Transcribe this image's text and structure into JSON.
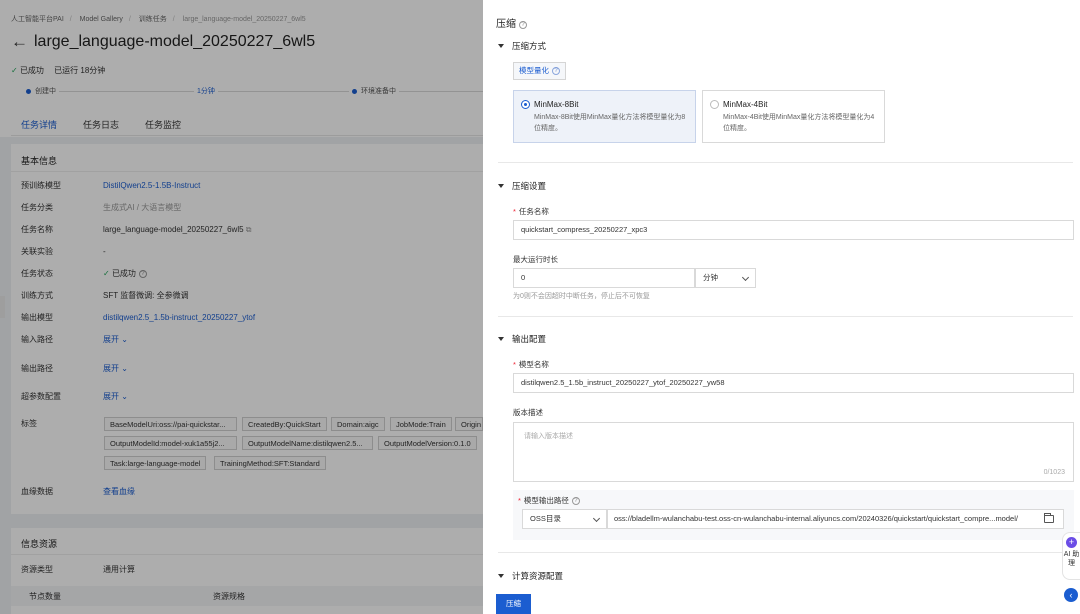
{
  "background": {
    "breadcrumb": [
      "人工智能平台PAI",
      "Model Gallery",
      "训练任务",
      "large_language-model_20250227_6wl5"
    ],
    "title": "large_language-model_20250227_6wl5",
    "status": "已成功",
    "runtime": "已运行 18分钟",
    "progress": {
      "step1": "创建中",
      "step2": "1分钟",
      "step3": "环境准备中"
    },
    "tabs": [
      "任务详情",
      "任务日志",
      "任务监控"
    ],
    "basic_info": {
      "title": "基本信息",
      "rows": [
        {
          "k": "预训练模型",
          "v": "DistilQwen2.5-1.5B-Instruct"
        },
        {
          "k": "任务分类",
          "v": "生成式AI / 大语言模型"
        },
        {
          "k": "任务名称",
          "v": "large_language-model_20250227_6wl5"
        },
        {
          "k": "关联实验",
          "v": "-"
        },
        {
          "k": "任务状态",
          "v": "已成功"
        },
        {
          "k": "训练方式",
          "v": "SFT 监督微调: 全参微调"
        },
        {
          "k": "输出模型",
          "v": "distilqwen2.5_1.5b-instruct_20250227_ytof"
        },
        {
          "k": "输入路径",
          "v": "展开"
        },
        {
          "k": "输出路径",
          "v": "展开"
        },
        {
          "k": "超参数配置",
          "v": "展开"
        },
        {
          "k": "标签",
          "v": ""
        },
        {
          "k": "血缘数据",
          "v": "查看血缘"
        }
      ],
      "tags": [
        "BaseModelUri:oss://pai-quickstar...",
        "CreatedBy:QuickStart",
        "Domain:aigc",
        "JobMode:Train",
        "Origin",
        "OutputModelId:model-xuk1a55j2...",
        "OutputModelName:distilqwen2.5...",
        "OutputModelVersion:0.1.0",
        "Task:large-language-model",
        "TrainingMethod:SFT:Standard"
      ]
    },
    "resource": {
      "title": "信息资源",
      "type_label": "资源类型",
      "type_value": "通用计算",
      "col_nodes": "节点数量",
      "col_spec": "资源规格"
    }
  },
  "drawer": {
    "title": "压缩",
    "section_method": "压缩方式",
    "quant_pill": "模型量化",
    "options": [
      {
        "name": "MinMax-8Bit",
        "desc": "MinMax-8Bit使用MinMax量化方法将模型量化为8位精度。",
        "selected": true
      },
      {
        "name": "MinMax-4Bit",
        "desc": "MinMax-4Bit使用MinMax量化方法将模型量化为4位精度。",
        "selected": false
      }
    ],
    "section_settings": "压缩设置",
    "task_name_label": "任务名称",
    "task_name_value": "quickstart_compress_20250227_xpc3",
    "max_runtime_label": "最大运行时长",
    "max_runtime_value": "0",
    "max_runtime_unit": "分钟",
    "max_runtime_hint": "为0则不会因超时中断任务，停止后不可恢复",
    "section_output": "输出配置",
    "model_name_label": "模型名称",
    "model_name_value": "distilqwen2.5_1.5b_instruct_20250227_ytof_20250227_yw58",
    "version_desc_label": "版本描述",
    "version_desc_placeholder": "请输入版本描述",
    "version_desc_count": "0/1023",
    "output_path_label": "模型输出路径",
    "output_path_type": "OSS目录",
    "output_path_value": "oss://bladellm-wulanchabu-test.oss-cn-wulanchabu-internal.aliyuncs.com/20240326/quickstart/quickstart_compre...model/",
    "section_compute": "计算资源配置",
    "submit_label": "压缩",
    "ai_label": "AI 助理"
  }
}
